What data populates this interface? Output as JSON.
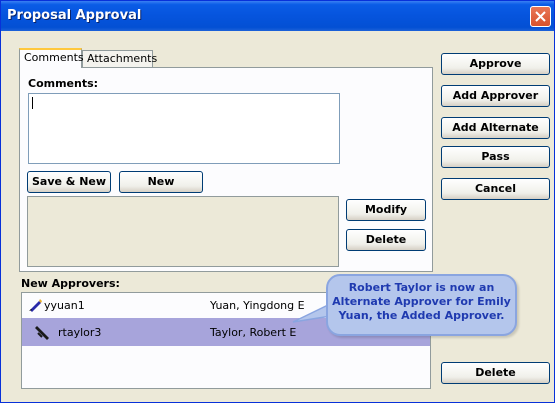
{
  "window": {
    "title": "Proposal Approval"
  },
  "tabs": [
    {
      "label": "Comments",
      "active": true
    },
    {
      "label": "Attachments",
      "active": false
    }
  ],
  "comments": {
    "label": "Comments:",
    "value": ""
  },
  "buttons": {
    "save_new": "Save & New",
    "new": "New",
    "modify": "Modify",
    "delete_mid": "Delete",
    "approve": "Approve",
    "add_approver": "Add Approver",
    "add_alternate": "Add Alternate",
    "pass": "Pass",
    "cancel": "Cancel",
    "delete_bottom": "Delete"
  },
  "approvers": {
    "label": "New Approvers:",
    "rows": [
      {
        "user_id": "yyuan1",
        "name": "Yuan, Yingdong E",
        "icon": "pen-icon",
        "selected": false
      },
      {
        "user_id": "rtaylor3",
        "name": "Taylor, Robert E",
        "icon": "alternate-pen-icon",
        "selected": true
      }
    ]
  },
  "callout": {
    "text": "Robert Taylor is now an Alternate Approver for Emily Yuan, the Added Approver."
  },
  "colors": {
    "titlebar": "#0654dd",
    "selected_row": "#a7a4db",
    "callout_bg": "#b4c6ec",
    "callout_text": "#1f3ab0"
  }
}
